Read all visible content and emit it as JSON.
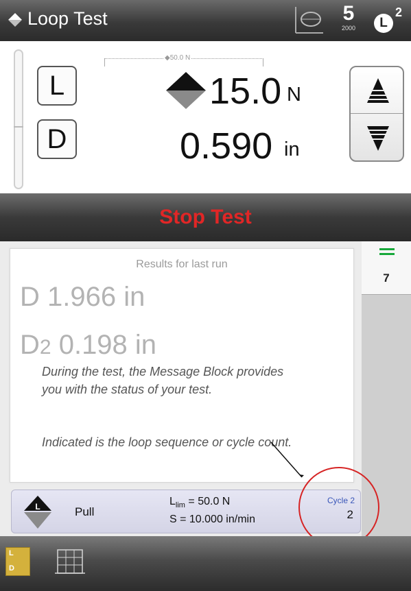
{
  "header": {
    "title": "Loop Test",
    "speed_value": "5",
    "speed_sub": "2000",
    "load_cell_letter": "L",
    "load_cell_sup": "2"
  },
  "readout": {
    "load_button": "L",
    "disp_button": "D",
    "range_label": "50.0 N",
    "load_value": "15.0",
    "load_unit": "N",
    "disp_value": "0.590",
    "disp_unit": "in"
  },
  "stop_button": {
    "label": "Stop Test",
    "color": "#e12626"
  },
  "results": {
    "title": "Results for last run",
    "d_label": "D",
    "d_value": "1.966 in",
    "d2_label": "D",
    "d2_sub": "2",
    "d2_value": "0.198 in"
  },
  "annotation": {
    "line1": "During the test, the Message Block provides",
    "line2": "you with the status of your test.",
    "line3": "Indicated is the loop sequence or cycle count."
  },
  "side_panel": {
    "count": "7",
    "accent": "#17a83a"
  },
  "status": {
    "direction": "Pull",
    "llim_prefix": "L",
    "llim_sub": "lim",
    "llim_value": " = 50.0 N",
    "speed": "S = 10.000 in/min",
    "cycle_label": "Cycle 2",
    "cycle_value": "2"
  },
  "toolbar": {
    "ld_top": "L",
    "ld_bottom": "D"
  }
}
